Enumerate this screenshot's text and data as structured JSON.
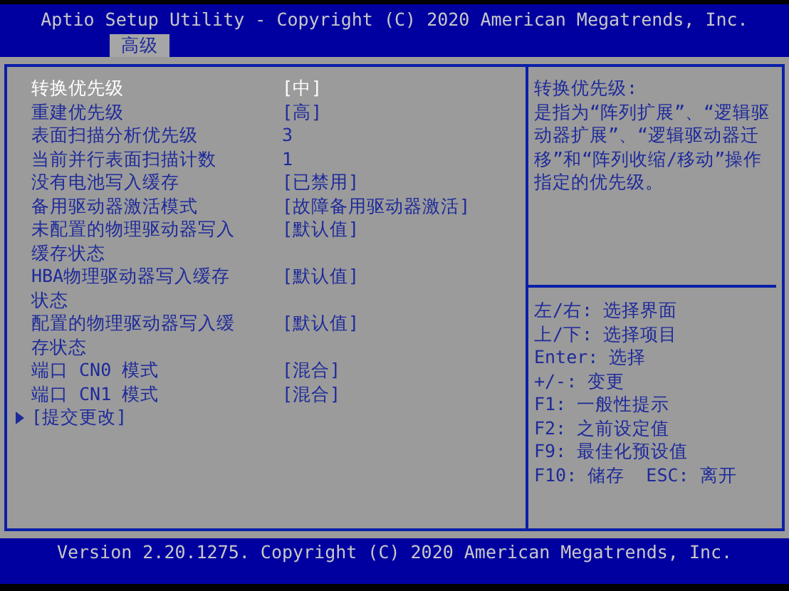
{
  "window": {
    "title": "Aptio Setup Utility - Copyright (C) 2020 American Megatrends, Inc."
  },
  "tabs": [
    {
      "label": "高级",
      "selected": true
    }
  ],
  "settings": [
    {
      "kind": "setting",
      "label": "转换优先级",
      "value": "[中]",
      "selected": true
    },
    {
      "kind": "setting",
      "label": "重建优先级",
      "value": "[高]",
      "selected": false
    },
    {
      "kind": "setting",
      "label": "表面扫描分析优先级",
      "value": "3",
      "selected": false
    },
    {
      "kind": "setting",
      "label": "当前并行表面扫描计数",
      "value": "1",
      "selected": false
    },
    {
      "kind": "setting",
      "label": "没有电池写入缓存",
      "value": "[已禁用]",
      "selected": false
    },
    {
      "kind": "setting",
      "label": "备用驱动器激活模式",
      "value": "[故障备用驱动器激活]",
      "selected": false
    },
    {
      "kind": "setting",
      "label": "未配置的物理驱动器写入缓存状态",
      "value": "[默认值]",
      "selected": false
    },
    {
      "kind": "setting",
      "label": "HBA物理驱动器写入缓存状态",
      "value": "[默认值]",
      "selected": false
    },
    {
      "kind": "setting",
      "label": "配置的物理驱动器写入缓存状态",
      "value": "[默认值]",
      "selected": false
    },
    {
      "kind": "setting",
      "label": "端口 CN0 模式",
      "value": "[混合]",
      "selected": false
    },
    {
      "kind": "setting",
      "label": "端口 CN1 模式",
      "value": "[混合]",
      "selected": false
    },
    {
      "kind": "submenu",
      "label": "[提交更改]",
      "selected": false
    }
  ],
  "help": {
    "title": "转换优先级:",
    "text": "是指为“阵列扩展”、“逻辑驱动器扩展”、“逻辑驱动器迁移”和“阵列收缩/移动”操作指定的优先级。"
  },
  "keys": [
    "左/右: 选择界面",
    "上/下: 选择项目",
    "Enter: 选择",
    "+/-: 变更",
    "F1: 一般性提示",
    "F2: 之前设定值",
    "F9: 最佳化预设值",
    "F10: 储存  ESC: 离开"
  ],
  "status_bar": "Version 2.20.1275. Copyright (C) 2020 American Megatrends, Inc."
}
